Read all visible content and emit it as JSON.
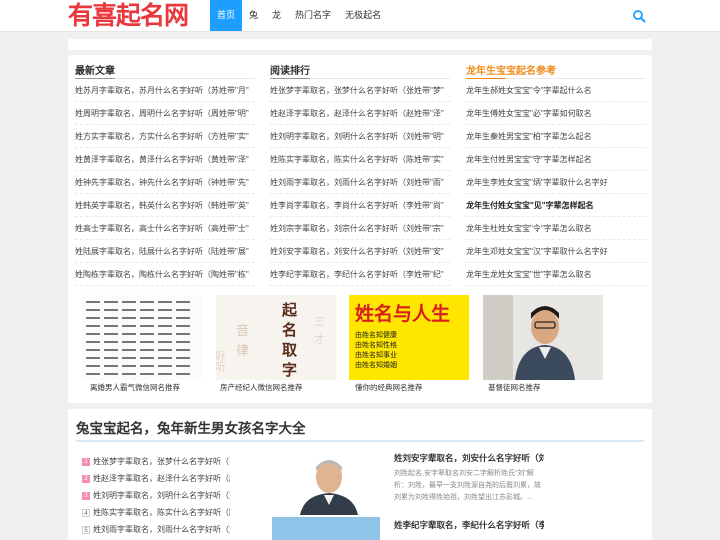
{
  "header": {
    "logo_text": "有喜起名网",
    "nav": [
      "首页",
      "兔",
      "龙",
      "热门名字",
      "无极起名"
    ],
    "active_index": 0,
    "search_icon": "search-icon"
  },
  "latest": {
    "title": "最新文章",
    "items": [
      "姓苏月字辈取名，苏月什么名字好听（苏姓带\"月\"",
      "姓周明字辈取名，周明什么名字好听（周姓带\"明\"",
      "姓方实字辈取名，方实什么名字好听（方姓带\"实\"",
      "姓黄泽字辈取名，黄泽什么名字好听（黄姓带\"泽\"",
      "姓钟先字辈取名，钟先什么名字好听（钟姓带\"先\"",
      "姓韩英字辈取名，韩英什么名字好听（韩姓带\"英\"",
      "姓高士字辈取名，高士什么名字好听（高姓带\"士\"",
      "姓陆展字辈取名，陆展什么名字好听（陆姓带\"展\"",
      "姓陶栋字辈取名，陶栋什么名字好听（陶姓带\"栋\""
    ]
  },
  "ranking": {
    "title": "阅读排行",
    "items": [
      "姓张梦字辈取名，张梦什么名字好听（张姓带\"梦\"",
      "姓赵泽字辈取名，赵泽什么名字好听（赵姓带\"泽\"",
      "姓刘明字辈取名，刘明什么名字好听（刘姓带\"明\"",
      "姓陈实字辈取名，陈实什么名字好听（陈姓带\"实\"",
      "姓刘雨字辈取名，刘雨什么名字好听（刘姓带\"雨\"",
      "姓李尚字辈取名，李尚什么名字好听（李姓带\"尚\"",
      "姓刘宗字辈取名，刘宗什么名字好听（刘姓带\"宗\"",
      "姓刘安字辈取名，刘安什么名字好听（刘姓带\"安\"",
      "姓李纪字辈取名，李纪什么名字好听（李姓带\"纪\""
    ]
  },
  "dragon": {
    "title": "龙年生宝宝起名参考",
    "items": [
      "龙年生郝姓女宝宝\"令\"字辈起什么名",
      "龙年生傅姓女宝宝\"必\"字辈如何取名",
      "龙年生秦姓男宝宝\"柏\"字辈怎么起名",
      "龙年生付姓男宝宝\"守\"字辈怎样起名",
      "龙年生李姓女宝宝\"炳\"字辈取什么名字好",
      "龙年生付姓女宝宝\"见\"字辈怎样起名",
      "龙年生杜姓女宝宝\"令\"字辈怎么取名",
      "龙年生邓姓女宝宝\"汉\"字辈取什么名字好",
      "龙年生龙姓女宝宝\"世\"字辈怎么取名"
    ],
    "bold_index": 5
  },
  "thumbs": [
    {
      "caption": "离婚男人霸气微信网名推荐",
      "text": "名字列表"
    },
    {
      "caption": "房产经纪人微信网名推荐",
      "text": "起名取字"
    },
    {
      "caption": "懂你的经典网名推荐",
      "text": "姓名与人生",
      "bullets": [
        "由姓名知健康",
        "由姓名知性格",
        "由姓名知事业",
        "由姓名知婚姻"
      ]
    },
    {
      "caption": "基督徒网名推荐",
      "text": ""
    }
  ],
  "section": {
    "title": "兔宝宝起名，兔年新生男女孩名字大全",
    "ranks": [
      {
        "n": "1",
        "text": "姓张梦字辈取名，张梦什么名字好听（张"
      },
      {
        "n": "2",
        "text": "姓赵泽字辈取名，赵泽什么名字好听（赵"
      },
      {
        "n": "3",
        "text": "姓刘明字辈取名，刘明什么名字好听（刘"
      },
      {
        "n": "4",
        "text": "姓陈实字辈取名，陈实什么名字好听（陈"
      },
      {
        "n": "5",
        "text": "姓刘雨字辈取名，刘雨什么名字好听（刘"
      }
    ],
    "article1": {
      "title": "姓刘安字辈取名，刘安什么名字好听（刘",
      "desc": "刘姓起名,安字辈取名刘安二字解析姓氏\"刘\"解析：刘姓，最早一支刘姓源自尧的后裔刘累，故刘累为刘姓得姓始祖，刘姓望出江苏彭城。..."
    },
    "article2": {
      "title": "姓李纪字辈取名，李纪什么名字好听（李",
      "desc": ""
    }
  },
  "colors": {
    "accent": "#1e9fff",
    "logo": "#e8383d",
    "orange": "#f08b1a",
    "rank_hot": "#f48fb1"
  }
}
